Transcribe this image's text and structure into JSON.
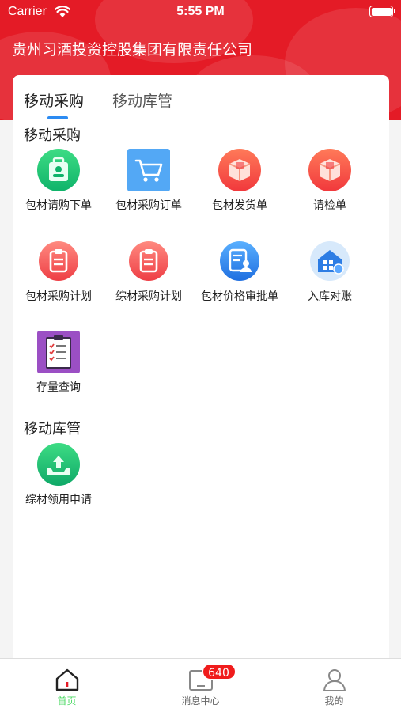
{
  "status_bar": {
    "carrier": "Carrier",
    "time": "5:55 PM"
  },
  "header": {
    "company_name": "贵州习酒投资控股集团有限责任公司"
  },
  "tabs": [
    {
      "label": "移动采购",
      "active": true
    },
    {
      "label": "移动库管",
      "active": false
    }
  ],
  "sections": {
    "purchase": {
      "title": "移动采购",
      "items": [
        {
          "label": "包材请购下单",
          "icon": "person-badge-icon"
        },
        {
          "label": "包材采购订单",
          "icon": "cart-icon"
        },
        {
          "label": "包材发货单",
          "icon": "box-icon"
        },
        {
          "label": "请检单",
          "icon": "box-icon"
        },
        {
          "label": "包材采购计划",
          "icon": "clipboard-icon"
        },
        {
          "label": "综材采购计划",
          "icon": "clipboard-icon"
        },
        {
          "label": "包材价格审批单",
          "icon": "document-person-icon"
        },
        {
          "label": "入库对账",
          "icon": "warehouse-icon"
        },
        {
          "label": "存量查询",
          "icon": "checklist-icon"
        }
      ]
    },
    "warehouse": {
      "title": "移动库管",
      "items": [
        {
          "label": "综材领用申请",
          "icon": "upload-tray-icon"
        }
      ]
    }
  },
  "tabbar": {
    "home": {
      "label": "首页",
      "active": true
    },
    "messages": {
      "label": "消息中心",
      "badge": "640"
    },
    "mine": {
      "label": "我的"
    }
  },
  "colors": {
    "brand_red": "#e41b26",
    "tab_indicator": "#2c8bf2",
    "active_tab_text": "#4cd964",
    "badge": "#f01c1c"
  }
}
